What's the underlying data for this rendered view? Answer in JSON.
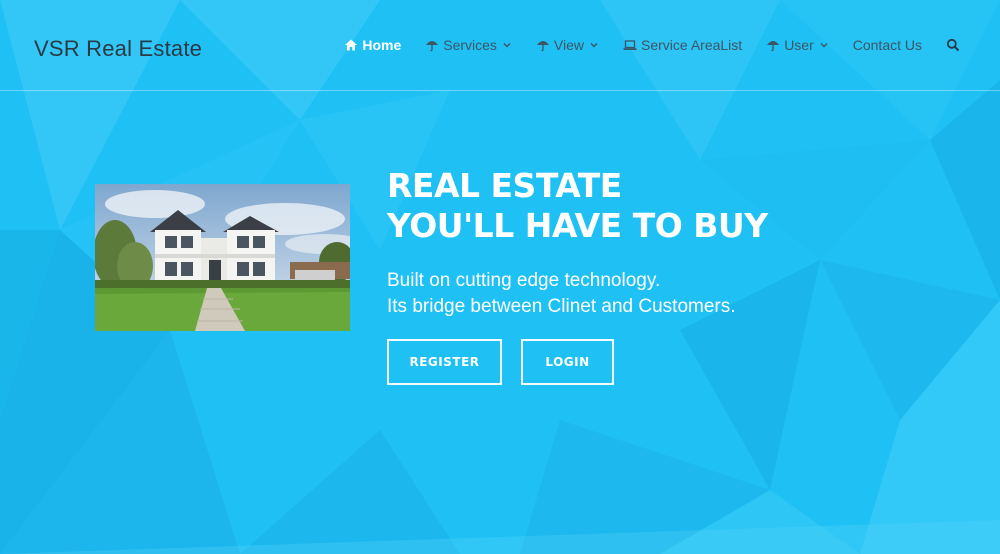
{
  "colors": {
    "background": "#1fc1f5",
    "brand_text": "#2b3a45",
    "nav_text": "#3d5665",
    "accent_white": "#ffffff"
  },
  "brand": {
    "name": "VSR Real Estate"
  },
  "nav": {
    "items": [
      {
        "label": "Home",
        "icon": "home-icon",
        "active": true,
        "dropdown": false
      },
      {
        "label": "Services",
        "icon": "umbrella-icon",
        "dropdown": true
      },
      {
        "label": "View",
        "icon": "umbrella-icon",
        "dropdown": true
      },
      {
        "label": "Service AreaList",
        "icon": "laptop-icon",
        "dropdown": false
      },
      {
        "label": "User",
        "icon": "umbrella-icon",
        "dropdown": true
      },
      {
        "label": "Contact Us",
        "icon": "",
        "dropdown": false
      }
    ],
    "search_icon": "search-icon"
  },
  "hero": {
    "image": "house-photo",
    "headline_line1": "REAL ESTATE",
    "headline_line2": "YOU'LL HAVE TO BUY",
    "sub_line1": "Built on cutting edge technology.",
    "sub_line2": "Its bridge between Clinet and Customers.",
    "register_label": "REGISTER",
    "login_label": "LOGIN"
  }
}
